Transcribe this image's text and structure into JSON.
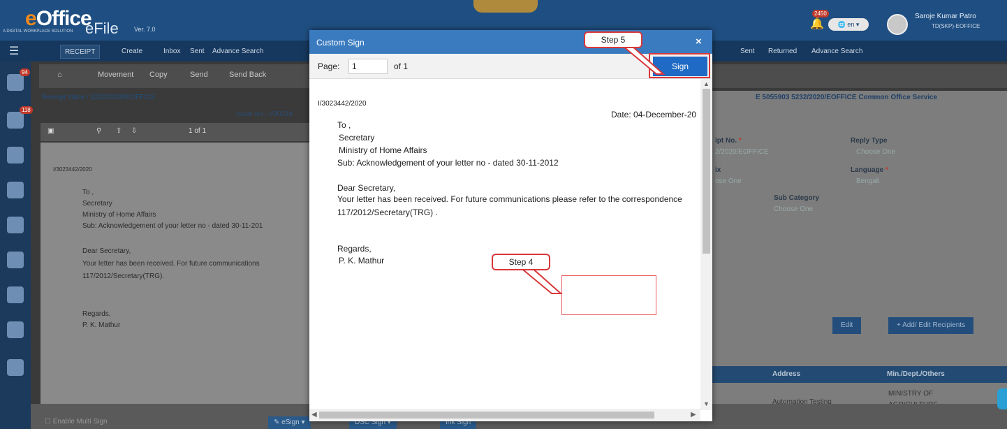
{
  "app": {
    "logo": "eOffice",
    "logo_tagline": "A DIGITAL WORKPLACE SOLUTION",
    "product": "eFile",
    "version": "Ver. 7.0",
    "notification_count": "2450",
    "language": "en",
    "user_name": "Saroje Kumar Patro",
    "user_dept": "TD(SKP)-EOFFICE"
  },
  "menu": {
    "left": [
      "RECEIPT",
      "Create",
      "Inbox",
      "Sent",
      "Advance Search"
    ],
    "right": [
      "Sent",
      "Returned",
      "Advance Search"
    ]
  },
  "toolbar": [
    "Movement",
    "Copy",
    "Send",
    "Send Back"
  ],
  "sidebar": {
    "badges": [
      "94",
      "118"
    ]
  },
  "left_pane": {
    "breadcrumb": "Receipt Inbox / 5232/2020/EOFFICE",
    "issue_no": "Issue No.: I/30234",
    "page_count": "1 of 1",
    "doc_lines": [
      "I/3023442/2020",
      "To ,",
      "Secretary",
      "Ministry of Home Affairs",
      "Sub: Acknowledgement of your letter no - dated 30-11-201",
      "Dear Secretary,",
      "Your letter has been received. For future communications",
      "117/2012/Secretary(TRG).",
      "Regards,",
      "P. K. Mathur"
    ],
    "enable_multi_sign": "Enable Multi Sign",
    "bottom_buttons": [
      "eSign",
      "DSC Sign",
      "Ink Sign"
    ]
  },
  "right_pane": {
    "header": "E 5055903 5232/2020/EOFFICE Common Office Service",
    "fields": [
      {
        "label": "ipt No.",
        "value": "2/2020/EOFFICE"
      },
      {
        "label": "Reply Type",
        "value": "Choose One"
      },
      {
        "label": "ix",
        "value": "ose One"
      },
      {
        "label": "Language",
        "value": "Bengali"
      },
      {
        "label": "Sub Category",
        "value": "Choose One"
      }
    ],
    "edit_button": "Edit",
    "add_recipients_button": "Add/ Edit Recipients",
    "table_headers": [
      "Address",
      "Min./Dept./Others"
    ],
    "table_row": [
      "Automation Testing",
      "MINISTRY OF",
      "AGRICULTURE"
    ]
  },
  "modal": {
    "title": "Custom Sign",
    "close_symbol": "×",
    "page_label": "Page:",
    "page_value": "1",
    "page_of": "of 1",
    "sign_button": "Sign",
    "letter": {
      "ref": "I/3023442/2020",
      "date": "Date: 04-December-20",
      "to": "To ,",
      "addressee": "Secretary",
      "ministry": "Ministry of Home Affairs",
      "subject": "Sub: Acknowledgement of your letter no - dated 30-11-2012",
      "salutation": "Dear Secretary,",
      "body1": "Your letter has been received. For future communications please refer to the correspondence",
      "body2": "117/2012/Secretary(TRG) .",
      "regards": "Regards,",
      "signatory": "P. K. Mathur"
    }
  },
  "callouts": {
    "step4": "Step 4",
    "step5": "Step 5"
  },
  "colors": {
    "header_blue": "#3a7bc0",
    "sign_button": "#1e6ac4",
    "callout_red": "#d9383a"
  }
}
